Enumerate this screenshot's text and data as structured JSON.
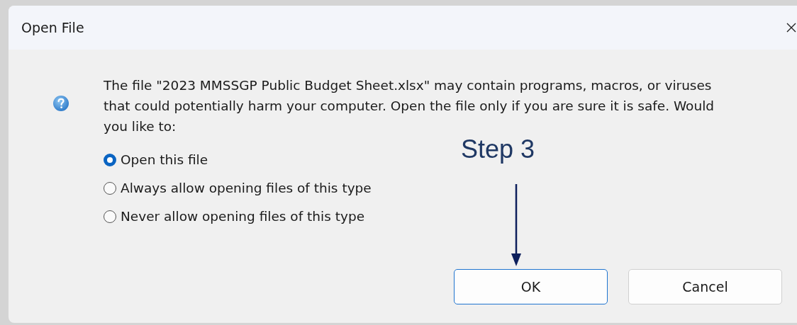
{
  "window": {
    "title": "Open File"
  },
  "message": "The file \"2023 MMSSGP Public Budget Sheet.xlsx\" may contain programs, macros, or viruses that could potentially harm your computer. Open the file only if you are sure it is safe. Would you like to:",
  "options": [
    {
      "label": "Open this file",
      "selected": true
    },
    {
      "label": "Always allow opening files of this type",
      "selected": false
    },
    {
      "label": "Never allow opening files of this type",
      "selected": false
    }
  ],
  "buttons": [
    {
      "label": "OK",
      "kind": "default"
    },
    {
      "label": "Cancel",
      "kind": "normal"
    }
  ],
  "annotation": {
    "label": "Step 3"
  }
}
